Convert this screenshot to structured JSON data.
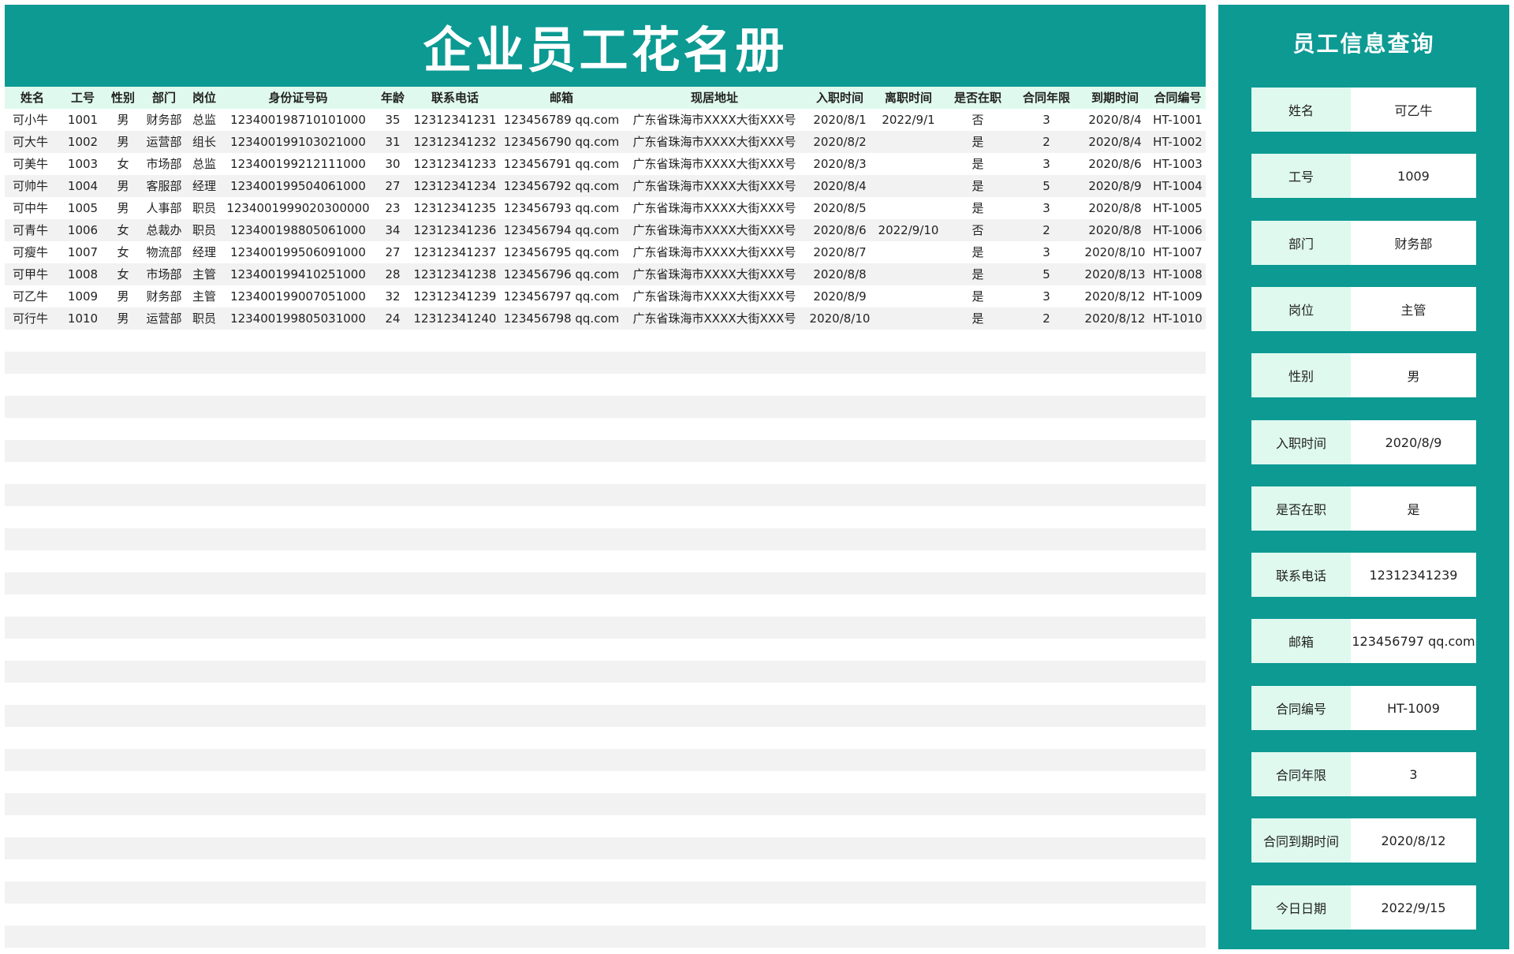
{
  "sheet": {
    "title": "企业员工花名册",
    "columns": [
      "姓名",
      "工号",
      "性别",
      "部门",
      "岗位",
      "身份证号码",
      "年龄",
      "联系电话",
      "邮箱",
      "现居地址",
      "入职时间",
      "离职时间",
      "是否在职",
      "合同年限",
      "到期时间",
      "合同编号"
    ],
    "rows": [
      [
        "可小牛",
        "1001",
        "男",
        "财务部",
        "总监",
        "123400198710101000",
        "35",
        "12312341231",
        "123456789 qq.com",
        "广东省珠海市XXXX大街XXX号",
        "2020/8/1",
        "2022/9/1",
        "否",
        "3",
        "2020/8/4",
        "HT-1001"
      ],
      [
        "可大牛",
        "1002",
        "男",
        "运营部",
        "组长",
        "123400199103021000",
        "31",
        "12312341232",
        "123456790 qq.com",
        "广东省珠海市XXXX大街XXX号",
        "2020/8/2",
        "",
        "是",
        "2",
        "2020/8/4",
        "HT-1002"
      ],
      [
        "可美牛",
        "1003",
        "女",
        "市场部",
        "总监",
        "123400199212111000",
        "30",
        "12312341233",
        "123456791 qq.com",
        "广东省珠海市XXXX大街XXX号",
        "2020/8/3",
        "",
        "是",
        "3",
        "2020/8/6",
        "HT-1003"
      ],
      [
        "可帅牛",
        "1004",
        "男",
        "客服部",
        "经理",
        "123400199504061000",
        "27",
        "12312341234",
        "123456792 qq.com",
        "广东省珠海市XXXX大街XXX号",
        "2020/8/4",
        "",
        "是",
        "5",
        "2020/8/9",
        "HT-1004"
      ],
      [
        "可中牛",
        "1005",
        "男",
        "人事部",
        "职员",
        "1234001999020300000",
        "23",
        "12312341235",
        "123456793 qq.com",
        "广东省珠海市XXXX大街XXX号",
        "2020/8/5",
        "",
        "是",
        "3",
        "2020/8/8",
        "HT-1005"
      ],
      [
        "可青牛",
        "1006",
        "女",
        "总裁办",
        "职员",
        "123400198805061000",
        "34",
        "12312341236",
        "123456794 qq.com",
        "广东省珠海市XXXX大街XXX号",
        "2020/8/6",
        "2022/9/10",
        "否",
        "2",
        "2020/8/8",
        "HT-1006"
      ],
      [
        "可瘦牛",
        "1007",
        "女",
        "物流部",
        "经理",
        "123400199506091000",
        "27",
        "12312341237",
        "123456795 qq.com",
        "广东省珠海市XXXX大街XXX号",
        "2020/8/7",
        "",
        "是",
        "3",
        "2020/8/10",
        "HT-1007"
      ],
      [
        "可甲牛",
        "1008",
        "女",
        "市场部",
        "主管",
        "123400199410251000",
        "28",
        "12312341238",
        "123456796 qq.com",
        "广东省珠海市XXXX大街XXX号",
        "2020/8/8",
        "",
        "是",
        "5",
        "2020/8/13",
        "HT-1008"
      ],
      [
        "可乙牛",
        "1009",
        "男",
        "财务部",
        "主管",
        "123400199007051000",
        "32",
        "12312341239",
        "123456797 qq.com",
        "广东省珠海市XXXX大街XXX号",
        "2020/8/9",
        "",
        "是",
        "3",
        "2020/8/12",
        "HT-1009"
      ],
      [
        "可行牛",
        "1010",
        "男",
        "运营部",
        "职员",
        "123400199805031000",
        "24",
        "12312341240",
        "123456798 qq.com",
        "广东省珠海市XXXX大街XXX号",
        "2020/8/10",
        "",
        "是",
        "2",
        "2020/8/12",
        "HT-1010"
      ]
    ]
  },
  "panel": {
    "title": "员工信息查询",
    "fields": [
      {
        "label": "姓名",
        "value": "可乙牛"
      },
      {
        "label": "工号",
        "value": "1009"
      },
      {
        "label": "部门",
        "value": "财务部"
      },
      {
        "label": "岗位",
        "value": "主管"
      },
      {
        "label": "性别",
        "value": "男"
      },
      {
        "label": "入职时间",
        "value": "2020/8/9"
      },
      {
        "label": "是否在职",
        "value": "是"
      },
      {
        "label": "联系电话",
        "value": "12312341239"
      },
      {
        "label": "邮箱",
        "value": "123456797 qq.com"
      },
      {
        "label": "合同编号",
        "value": "HT-1009"
      },
      {
        "label": "合同年限",
        "value": "3"
      },
      {
        "label": "合同到期时间",
        "value": "2020/8/12"
      },
      {
        "label": "今日日期",
        "value": "2022/9/15"
      }
    ]
  },
  "colors": {
    "accent": "#0c9a93",
    "header_bg": "#dff9ee",
    "stripe": "#f2f2f2"
  }
}
